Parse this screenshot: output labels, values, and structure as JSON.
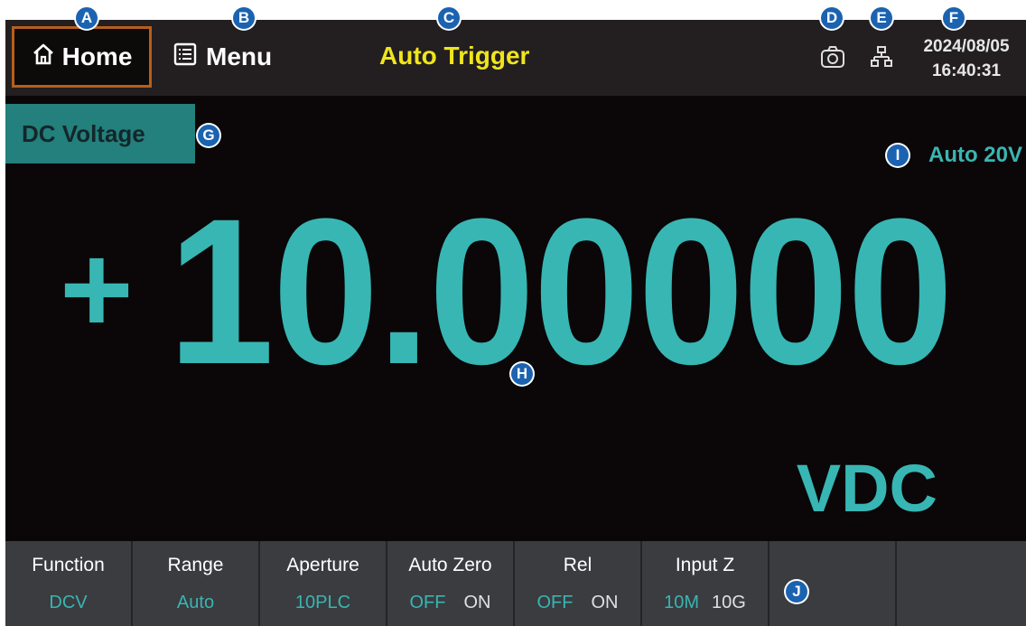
{
  "topbar": {
    "home_label": "Home",
    "menu_label": "Menu",
    "trigger_mode": "Auto Trigger",
    "date": "2024/08/05",
    "time": "16:40:31",
    "icons": [
      "home-icon",
      "menu-list-icon",
      "camera-icon",
      "network-icon"
    ]
  },
  "measurement": {
    "function_label": "DC Voltage",
    "range_indicator": "Auto 20V",
    "sign": "+",
    "value": "10.00000",
    "unit": "VDC"
  },
  "softkeys": [
    {
      "label": "Function",
      "value": "DCV"
    },
    {
      "label": "Range",
      "value": "Auto"
    },
    {
      "label": "Aperture",
      "value": "10PLC"
    },
    {
      "label": "Auto Zero",
      "options": [
        "OFF",
        "ON"
      ],
      "selected": "OFF"
    },
    {
      "label": "Rel",
      "options": [
        "OFF",
        "ON"
      ],
      "selected": "OFF"
    },
    {
      "label": "Input Z",
      "options": [
        "10M",
        "10G"
      ],
      "selected": "10M"
    },
    {
      "label": ""
    },
    {
      "label": ""
    }
  ],
  "callouts": [
    "A",
    "B",
    "C",
    "D",
    "E",
    "F",
    "G",
    "H",
    "I",
    "J"
  ],
  "colors": {
    "accent": "#37b6b4",
    "trigger": "#f0e51c",
    "home_border": "#b65f1c",
    "marker": "#1b63b0"
  }
}
